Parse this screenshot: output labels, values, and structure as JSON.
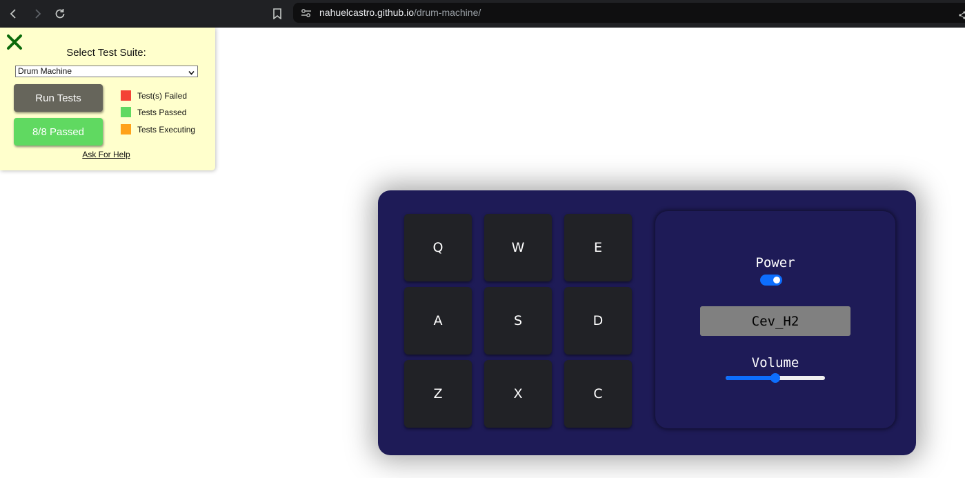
{
  "browser": {
    "url_host": "nahuelcastro.github.io",
    "url_path": "/drum-machine/"
  },
  "test_panel": {
    "title": "Select Test Suite:",
    "suite_selected": "Drum Machine",
    "run_label": "Run Tests",
    "status_label": "8/8 Passed",
    "legend": [
      {
        "label": "Test(s) Failed",
        "color": "#f44336"
      },
      {
        "label": "Tests Passed",
        "color": "#60d961"
      },
      {
        "label": "Tests Executing",
        "color": "#ffa21a"
      }
    ],
    "help_label": "Ask For Help"
  },
  "drum": {
    "pads": [
      "Q",
      "W",
      "E",
      "A",
      "S",
      "D",
      "Z",
      "X",
      "C"
    ],
    "power_label": "Power",
    "power_on": true,
    "display_text": "Cev_H2",
    "volume_label": "Volume",
    "volume_value": 0.5
  },
  "colors": {
    "machine_bg": "#1e1b57",
    "pad_bg": "#212226",
    "accent": "#0d6efd"
  }
}
